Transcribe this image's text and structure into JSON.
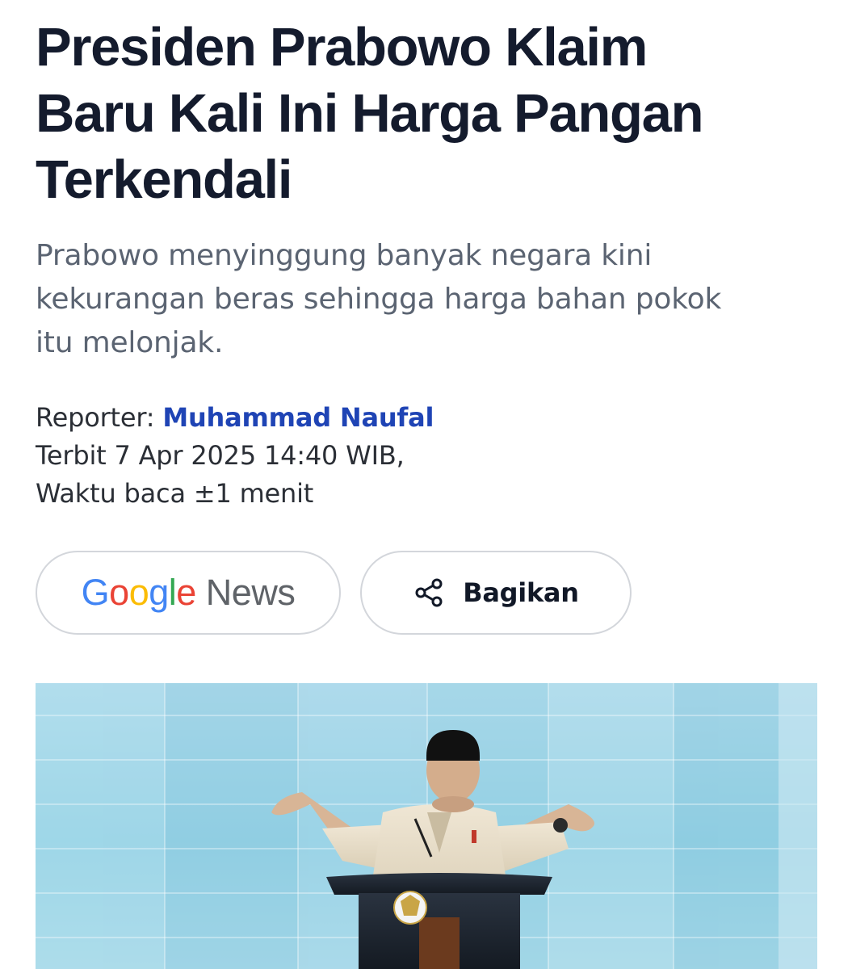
{
  "article": {
    "headline_lines": [
      "Presiden Prabowo Klaim",
      "Baru Kali Ini Harga Pangan",
      "Terkendali"
    ],
    "lead_lines": [
      "Prabowo menyinggung banyak negara kini",
      "kekurangan beras sehingga harga bahan pokok",
      "itu melonjak."
    ],
    "meta": {
      "reporter_label": "Reporter:",
      "reporter_name": "Muhammad Naufal",
      "published": "Terbit 7 Apr 2025 14:40 WIB,",
      "read_time": "Waktu baca ±1 menit"
    },
    "buttons": {
      "google_news": {
        "google_letters": [
          "G",
          "o",
          "o",
          "g",
          "l",
          "e"
        ],
        "news_word": "News"
      },
      "share_label": "Bagikan"
    }
  },
  "colors": {
    "google_blue": "#4285F4",
    "google_red": "#EA4335",
    "google_yellow": "#FBBC05",
    "google_green": "#34A853",
    "reporter_link": "#1f44b5",
    "headline": "#141b2d",
    "lead": "#5b6472"
  },
  "icons": {
    "share": "share-nodes-icon"
  }
}
